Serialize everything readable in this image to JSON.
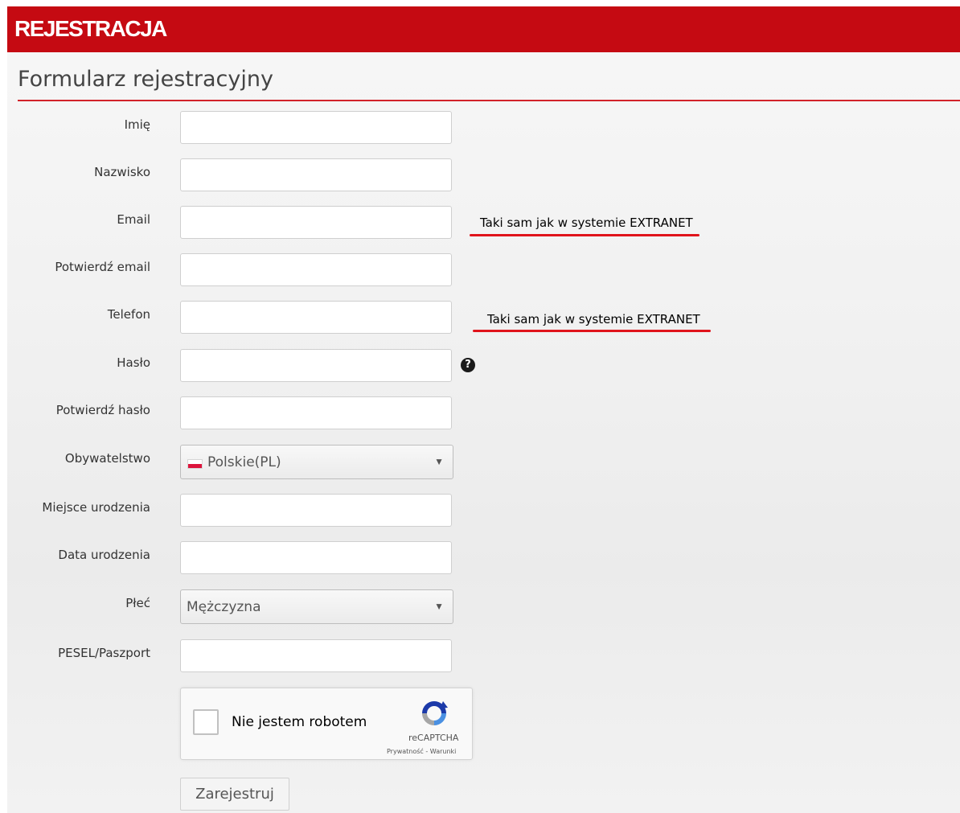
{
  "header": {
    "title": "REJESTRACJA",
    "color": "#c50a12"
  },
  "form": {
    "title": "Formularz rejestracyjny",
    "fields": {
      "first_name": {
        "label": "Imię",
        "value": ""
      },
      "last_name": {
        "label": "Nazwisko",
        "value": ""
      },
      "email": {
        "label": "Email",
        "value": ""
      },
      "email_confirm": {
        "label": "Potwierdź email",
        "value": ""
      },
      "phone": {
        "label": "Telefon",
        "value": ""
      },
      "password": {
        "label": "Hasło",
        "value": ""
      },
      "password_confirm": {
        "label": "Potwierdź hasło",
        "value": ""
      },
      "citizenship": {
        "label": "Obywatelstwo",
        "value": "Polskie(PL)",
        "icon": "poland-flag-icon"
      },
      "birthplace": {
        "label": "Miejsce urodzenia",
        "value": ""
      },
      "birthdate": {
        "label": "Data urodzenia",
        "value": ""
      },
      "gender": {
        "label": "Płeć",
        "value": "Mężczyzna"
      },
      "pesel_passport": {
        "label": "PESEL/Paszport",
        "value": ""
      }
    },
    "help_icon_glyph": "?",
    "submit_label": "Zarejestruj"
  },
  "annotations": {
    "email_note": "Taki sam jak w systemie EXTRANET",
    "phone_note": "Taki sam jak w systemie EXTRANET",
    "underline_color": "#e0141c"
  },
  "captcha": {
    "label": "Nie jestem robotem",
    "brand": "reCAPTCHA",
    "links": "Prywatność - Warunki"
  }
}
